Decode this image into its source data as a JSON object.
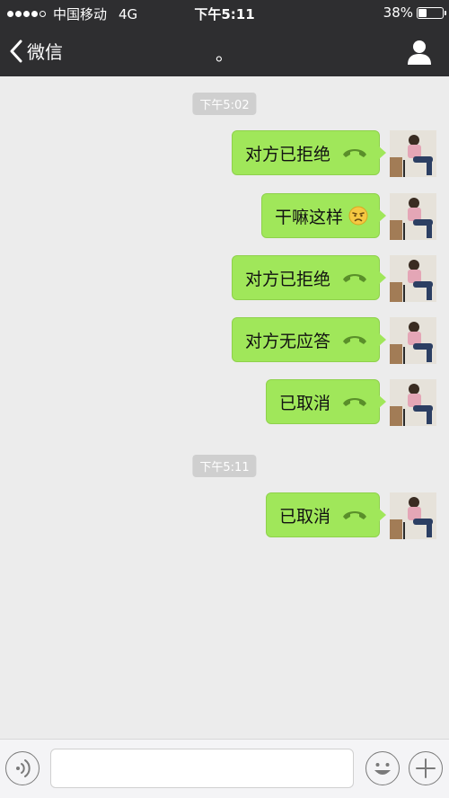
{
  "status_bar": {
    "carrier": "中国移动",
    "network": "4G",
    "time": "下午5:11",
    "battery_percent": "38%",
    "signal_bars_filled": 4
  },
  "nav": {
    "back_label": "微信",
    "title": "。"
  },
  "timestamps": [
    "下午5:02",
    "下午5:11"
  ],
  "messages": [
    {
      "text": "对方已拒绝",
      "icon": "phone-icon"
    },
    {
      "text": "干嘛这样",
      "icon": "sad-face-emoji"
    },
    {
      "text": "对方已拒绝",
      "icon": "phone-icon"
    },
    {
      "text": "对方无应答",
      "icon": "phone-icon"
    },
    {
      "text": "已取消",
      "icon": "phone-icon"
    },
    {
      "text": "已取消",
      "icon": "phone-icon"
    }
  ],
  "colors": {
    "bar_bg": "#2e2e30",
    "chat_bg": "#ececec",
    "bubble_green": "#a0e75a",
    "phone_icon": "#5a8f2a"
  }
}
